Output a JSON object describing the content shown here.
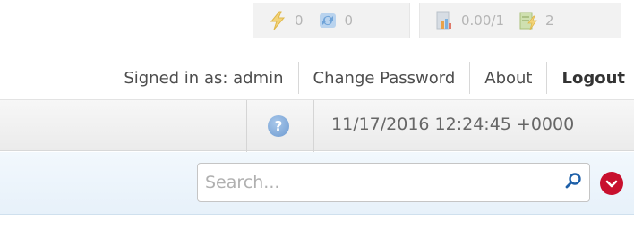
{
  "status": {
    "alerts_count": "0",
    "sync_count": "0",
    "ratio": "0.00/1",
    "tasks_count": "2",
    "icons": [
      "lightning-icon",
      "refresh-icon",
      "chart-icon",
      "task-lightning-icon"
    ]
  },
  "user_nav": {
    "signed_in": "Signed in as: admin",
    "change_password": "Change Password",
    "about": "About",
    "logout": "Logout"
  },
  "toolbar": {
    "help_label": "?",
    "datetime": "11/17/2016 12:24:45 +0000"
  },
  "search": {
    "placeholder": "Search...",
    "value": ""
  },
  "colors": {
    "accent_red": "#c8102e",
    "help_blue": "#6d9ad1",
    "search_band": "#e7f1fa"
  }
}
